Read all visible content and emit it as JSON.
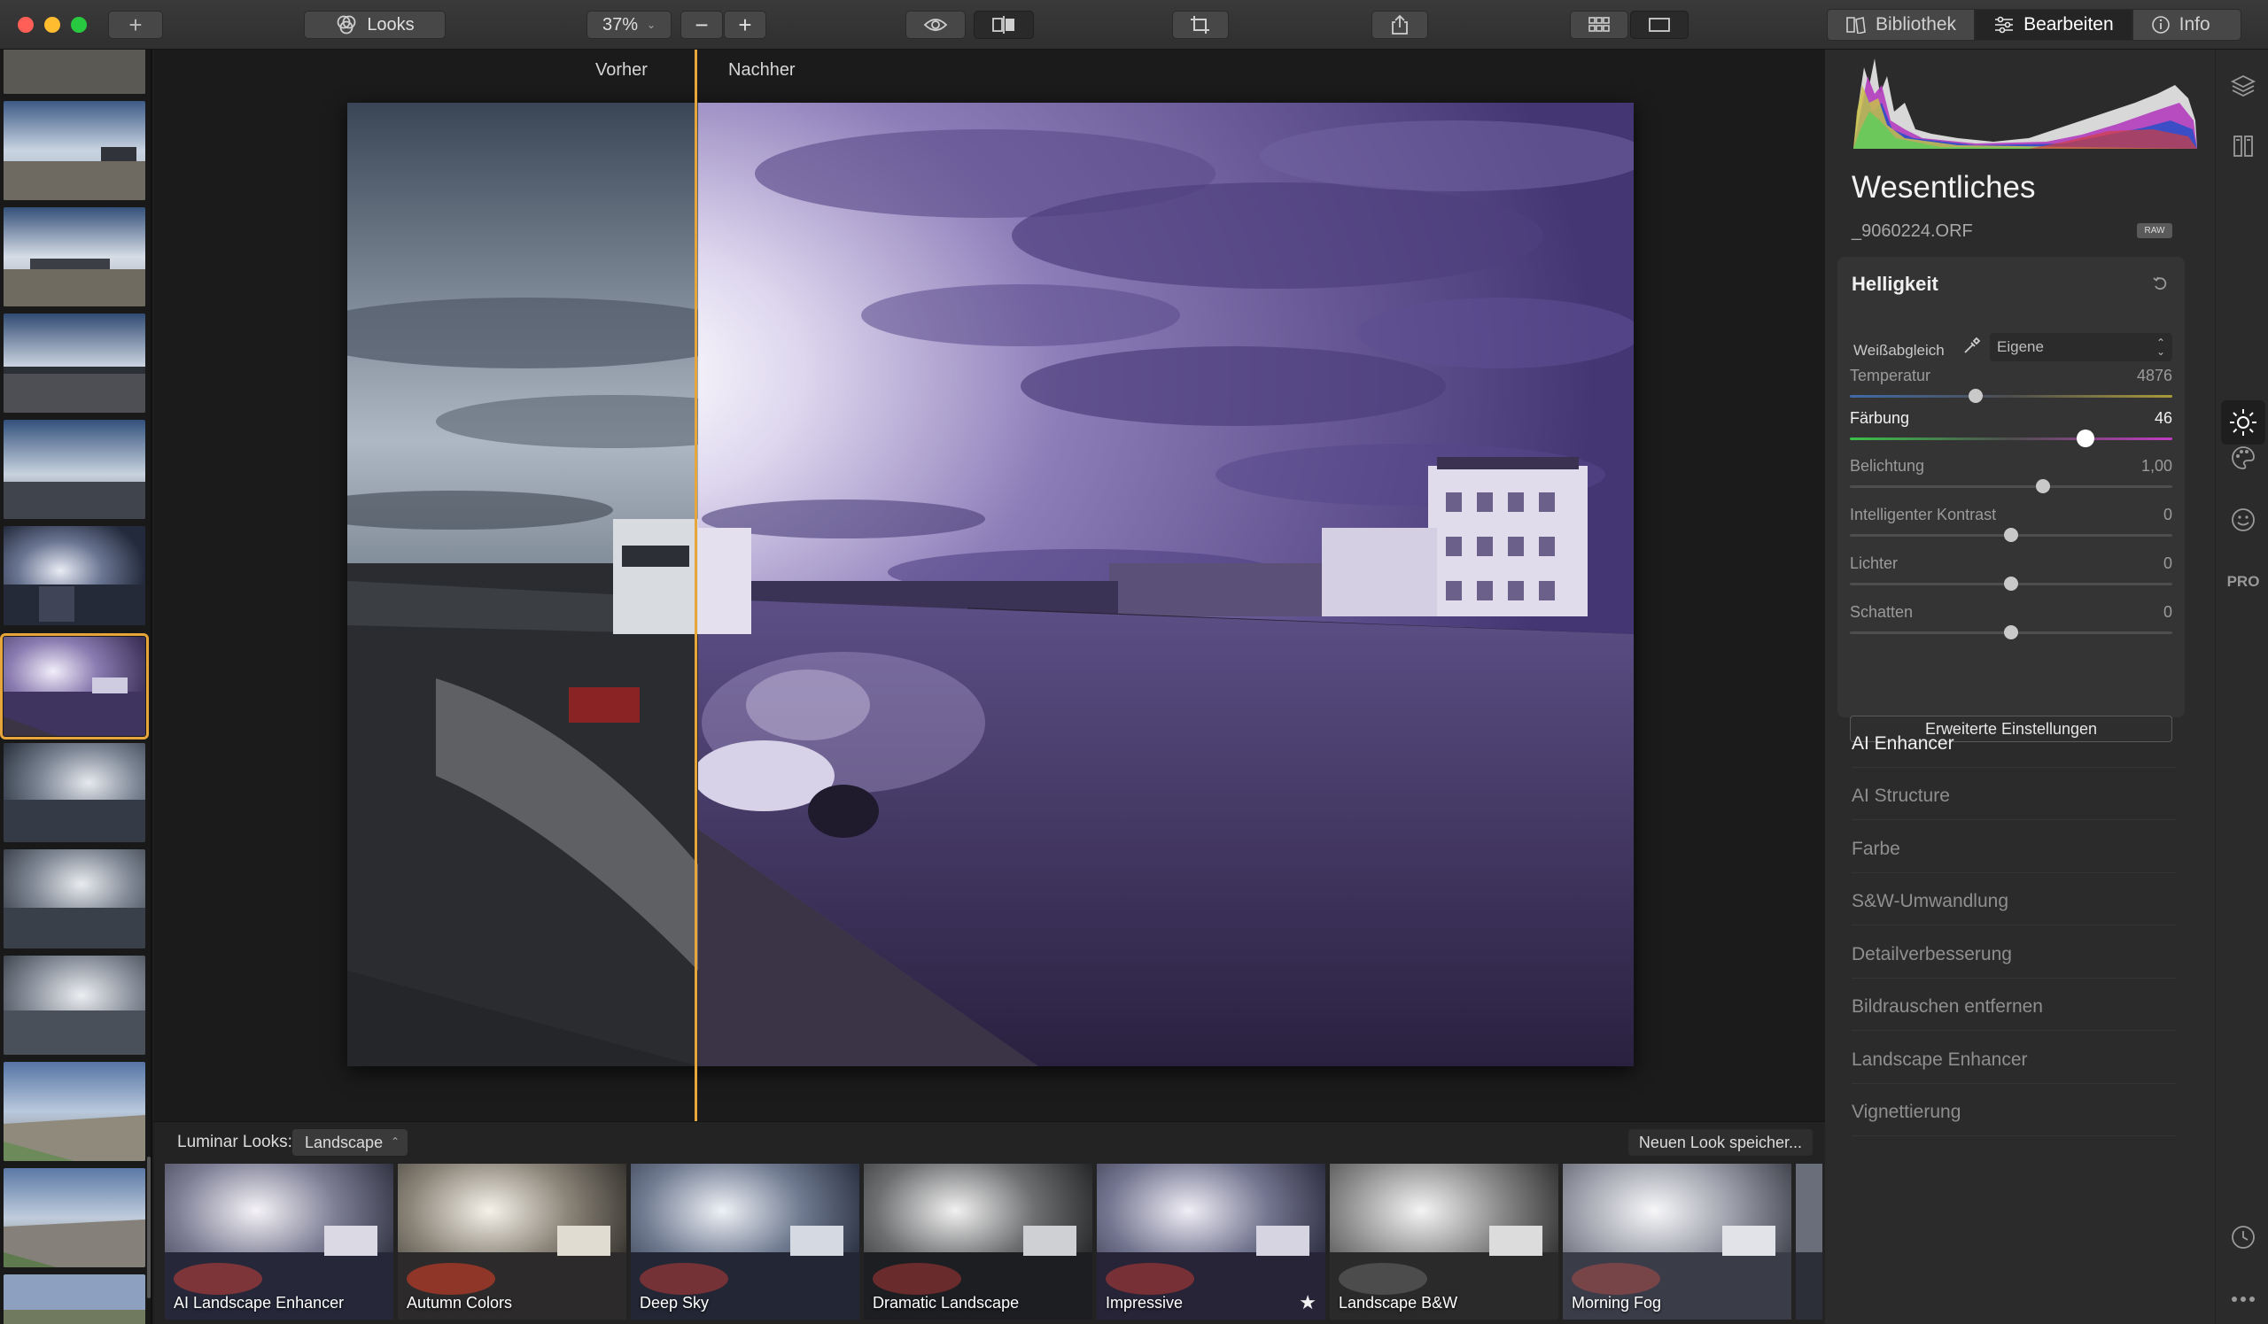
{
  "toolbar": {
    "add_label": "+",
    "looks_label": "Looks",
    "zoom_value": "37%",
    "zoom_out_label": "−",
    "zoom_in_label": "+",
    "tabs": [
      {
        "label": "Bibliothek",
        "icon": "library-icon",
        "active": false
      },
      {
        "label": "Bearbeiten",
        "icon": "sliders-icon",
        "active": true
      },
      {
        "label": "Info",
        "icon": "info-icon",
        "active": false
      }
    ]
  },
  "compare": {
    "before_label": "Vorher",
    "after_label": "Nachher"
  },
  "looks_strip": {
    "label": "Luminar Looks:",
    "category": "Landscape",
    "save_label": "Neuen Look speicher...",
    "items": [
      {
        "name": "AI Landscape Enhancer",
        "favorite": false
      },
      {
        "name": "Autumn Colors",
        "favorite": false
      },
      {
        "name": "Deep Sky",
        "favorite": false
      },
      {
        "name": "Dramatic Landscape",
        "favorite": false
      },
      {
        "name": "Impressive",
        "favorite": true
      },
      {
        "name": "Landscape B&W",
        "favorite": false
      },
      {
        "name": "Morning Fog",
        "favorite": false
      }
    ]
  },
  "panel": {
    "title": "Wesentliches",
    "filename": "_9060224.ORF",
    "raw_badge": "RAW",
    "helligkeit": {
      "title": "Helligkeit",
      "wb_label": "Weißabgleich",
      "wb_value": "Eigene",
      "sliders": [
        {
          "label": "Temperatur",
          "value": "4876",
          "position": 0.39,
          "highlight": false
        },
        {
          "label": "Färbung",
          "value": "46",
          "position": 0.73,
          "highlight": true
        },
        {
          "label": "Belichtung",
          "value": "1,00",
          "position": 0.6,
          "highlight": false
        },
        {
          "label": "Intelligenter Kontrast",
          "value": "0",
          "position": 0.5,
          "highlight": false
        },
        {
          "label": "Lichter",
          "value": "0",
          "position": 0.5,
          "highlight": false
        },
        {
          "label": "Schatten",
          "value": "0",
          "position": 0.5,
          "highlight": false
        }
      ],
      "advanced_label": "Erweiterte Einstellungen"
    },
    "sections": [
      "AI Enhancer",
      "AI Structure",
      "Farbe",
      "S&W-Umwandlung",
      "Detailverbesserung",
      "Bildrauschen entfernen",
      "Landscape Enhancer",
      "Vignettierung"
    ],
    "side_icons": [
      "layers-icon",
      "presets-icon",
      "sun-icon",
      "palette-icon",
      "face-icon",
      "pro-label-icon",
      "history-icon",
      "more-icon"
    ],
    "pro_label": "PRO"
  },
  "colors": {
    "accent": "#e6a63b",
    "panel_bg": "#2b2b2b",
    "card_bg": "#343434"
  }
}
